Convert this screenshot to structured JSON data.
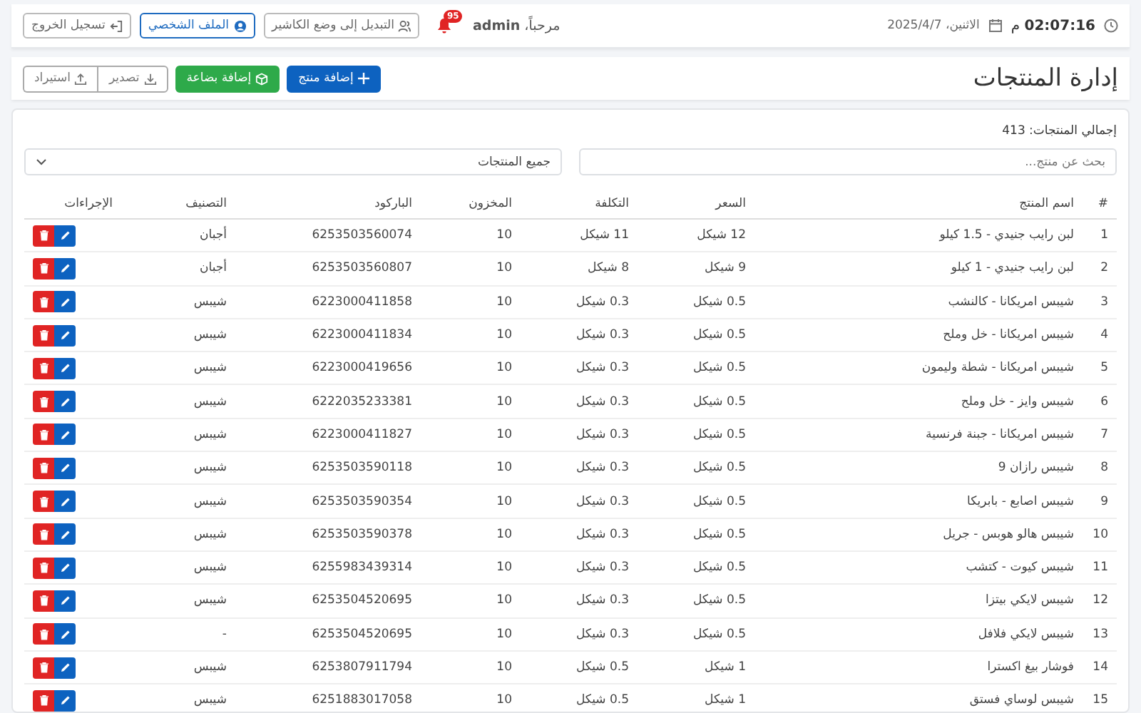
{
  "header": {
    "time": "**02:07:16** م",
    "date": "الاثنين، 2025/4/7",
    "greeting": "مرحباً، **admin**",
    "notifications_count": "95",
    "buttons": [
      {
        "kind": "cashier",
        "label": "التبديل إلى وضع الكاشير"
      },
      {
        "kind": "profile",
        "label": "الملف الشخصي"
      },
      {
        "kind": "logout",
        "label": "تسجيل الخروج"
      }
    ]
  },
  "page": {
    "title": "إدارة المنتجات",
    "actions": [
      {
        "kind": "add",
        "label": "إضافة منتج"
      },
      {
        "kind": "stock",
        "label": "إضافة بضاعة"
      },
      {
        "kind": "export",
        "label": "تصدير"
      },
      {
        "kind": "import",
        "label": "استيراد"
      }
    ]
  },
  "products": {
    "total": "إجمالي المنتجات: 413",
    "search": {
      "placeholder": "بحث عن منتج..."
    },
    "filter": {
      "value": "جميع المنتجات"
    },
    "table": {
      "columns": [
        "#",
        "اسم المنتج",
        "السعر",
        "التكلفة",
        "المخزون",
        "الباركود",
        "التصنيف",
        "الإجراءات"
      ],
      "rows": [
        [
          "1",
          "لبن رايب جنيدي - 1.5 كيلو",
          "12 شيكل",
          "11 شيكل",
          "10",
          "6253503560074",
          "أجبان"
        ],
        [
          "2",
          "لبن رايب جنيدي - 1 كيلو",
          "9 شيكل",
          "8 شيكل",
          "10",
          "6253503560807",
          "أجبان"
        ],
        [
          "3",
          "شيبس امريكانا - كالنشب",
          "0.5 شيكل",
          "0.3 شيكل",
          "10",
          "6223000411858",
          "شيبس"
        ],
        [
          "4",
          "شيبس امريكانا - خل وملح",
          "0.5 شيكل",
          "0.3 شيكل",
          "10",
          "6223000411834",
          "شيبس"
        ],
        [
          "5",
          "شيبس امريكانا - شطة وليمون",
          "0.5 شيكل",
          "0.3 شيكل",
          "10",
          "6223000419656",
          "شيبس"
        ],
        [
          "6",
          "شيبس وايز - خل وملح",
          "0.5 شيكل",
          "0.3 شيكل",
          "10",
          "6222035233381",
          "شيبس"
        ],
        [
          "7",
          "شيبس امريكانا - جبنة فرنسية",
          "0.5 شيكل",
          "0.3 شيكل",
          "10",
          "6223000411827",
          "شيبس"
        ],
        [
          "8",
          "شيبس رازان 9",
          "0.5 شيكل",
          "0.3 شيكل",
          "10",
          "6253503590118",
          "شيبس"
        ],
        [
          "9",
          "شيبس اصابع - بابريكا",
          "0.5 شيكل",
          "0.3 شيكل",
          "10",
          "6253503590354",
          "شيبس"
        ],
        [
          "10",
          "شيبس هالو هوبس - جريل",
          "0.5 شيكل",
          "0.3 شيكل",
          "10",
          "6253503590378",
          "شيبس"
        ],
        [
          "11",
          "شيبس كيوت - كتشب",
          "0.5 شيكل",
          "0.3 شيكل",
          "10",
          "6255983439314",
          "شيبس"
        ],
        [
          "12",
          "شيبس لايكي بيتزا",
          "0.5 شيكل",
          "0.3 شيكل",
          "10",
          "6253504520695",
          "شيبس"
        ],
        [
          "13",
          "شيبس لايكي فلافل",
          "0.5 شيكل",
          "0.3 شيكل",
          "10",
          "6253504520695",
          "-"
        ],
        [
          "14",
          "فوشار بيغ اكسترا",
          "1 شيكل",
          "0.5 شيكل",
          "10",
          "6253807911794",
          "شيبس"
        ],
        [
          "15",
          "شيبس لوساي فستق",
          "1 شيكل",
          "0.5 شيكل",
          "10",
          "6251883017058",
          "شيبس"
        ]
      ]
    }
  }
}
